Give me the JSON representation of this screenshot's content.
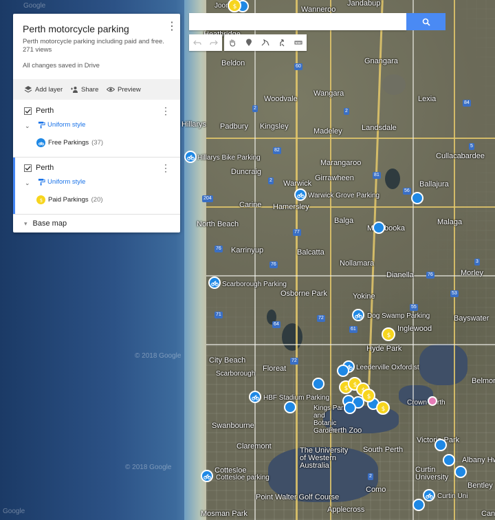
{
  "panel": {
    "title": "Perth motorcycle parking",
    "description": "Perth motorcycle parking including paid and free.",
    "views": "271 views",
    "saved_status": "All changes saved in Drive",
    "tools": {
      "add_layer": "Add layer",
      "share": "Share",
      "preview": "Preview"
    },
    "layers": [
      {
        "name": "Perth",
        "style": "Uniform style",
        "item_label": "Free Parkings",
        "item_count": "(37)",
        "checked": true,
        "color": "#1e88e5"
      },
      {
        "name": "Perth",
        "style": "Uniform style",
        "item_label": "Paid Parkings",
        "item_count": "(20)",
        "checked": true,
        "color": "#f7d51e"
      }
    ],
    "base_map": "Base map"
  },
  "search": {
    "value": "",
    "placeholder": ""
  },
  "map": {
    "places": [
      {
        "name": "Joondalup"
      },
      {
        "name": "Wanneroo"
      },
      {
        "name": "Jandabup"
      },
      {
        "name": "Heathridge"
      },
      {
        "name": "Beldon"
      },
      {
        "name": "Gnangara"
      },
      {
        "name": "Hillarys"
      },
      {
        "name": "Woodvale"
      },
      {
        "name": "Wangara"
      },
      {
        "name": "Lexia"
      },
      {
        "name": "Padbury"
      },
      {
        "name": "Kingsley"
      },
      {
        "name": "Madeley"
      },
      {
        "name": "Landsdale"
      },
      {
        "name": "Cullacabardee"
      },
      {
        "name": "Duncraig"
      },
      {
        "name": "Marangaroo"
      },
      {
        "name": "Girrawheen"
      },
      {
        "name": "Ballajura"
      },
      {
        "name": "Warwick"
      },
      {
        "name": "Carine"
      },
      {
        "name": "Hamersley"
      },
      {
        "name": "North Beach"
      },
      {
        "name": "Balga"
      },
      {
        "name": "Mirrabooka"
      },
      {
        "name": "Malaga"
      },
      {
        "name": "Karrinyup"
      },
      {
        "name": "Balcatta"
      },
      {
        "name": "Nollamara"
      },
      {
        "name": "Dianella"
      },
      {
        "name": "Morley"
      },
      {
        "name": "Osborne Park"
      },
      {
        "name": "Yokine"
      },
      {
        "name": "Inglewood"
      },
      {
        "name": "Bayswater"
      },
      {
        "name": "City Beach"
      },
      {
        "name": "Floreat"
      },
      {
        "name": "Hyde Park"
      },
      {
        "name": "Belmont"
      },
      {
        "name": "Perth Zoo"
      },
      {
        "name": "Swanbourne"
      },
      {
        "name": "Claremont"
      },
      {
        "name": "The University of Western Australia"
      },
      {
        "name": "South Perth"
      },
      {
        "name": "Victoria Park"
      },
      {
        "name": "Cottesloe"
      },
      {
        "name": "Curtin University"
      },
      {
        "name": "Albany Hwy"
      },
      {
        "name": "Bentley"
      },
      {
        "name": "Point Walter Golf Course"
      },
      {
        "name": "Como"
      },
      {
        "name": "Applecross"
      },
      {
        "name": "Mosman Park"
      },
      {
        "name": "Cann"
      },
      {
        "name": "Kings Park and Botanic Garden"
      },
      {
        "name": "Crown Perth"
      },
      {
        "name": "Scarborough"
      }
    ],
    "pin_labels": [
      "Hillarys Bike Parking",
      "Warwick Grove Parking",
      "Scarborough Parking",
      "Dog Swamp Parking",
      "Leederville Oxford st",
      "HBF Stadium Parking",
      "Cottesloe parking",
      "Curtin Uni"
    ],
    "watermarks": [
      "© 2018 Google",
      "© 2018 Google",
      "Google",
      "Google"
    ]
  }
}
